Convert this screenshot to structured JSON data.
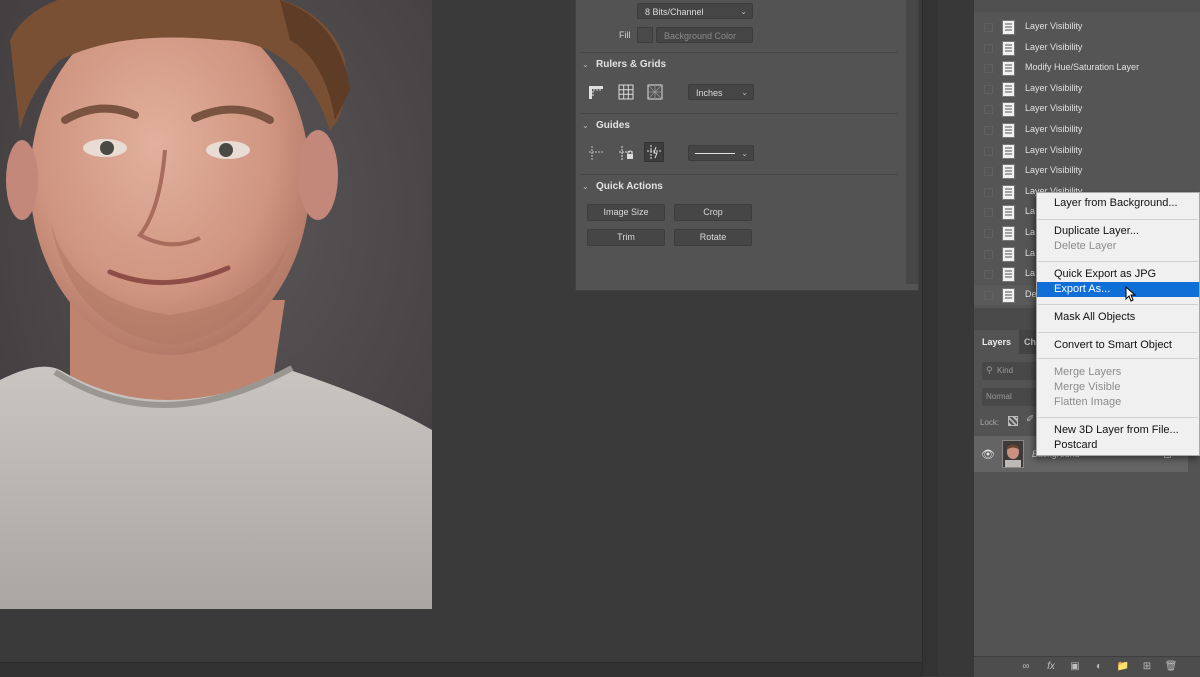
{
  "properties": {
    "bit_depth": "8 Bits/Channel",
    "fill_label": "Fill",
    "fill_value": "Background Color",
    "rulers_section": "Rulers & Grids",
    "units": "Inches",
    "guides_section": "Guides",
    "quick_actions_section": "Quick Actions",
    "buttons": {
      "image_size": "Image Size",
      "crop": "Crop",
      "trim": "Trim",
      "rotate": "Rotate"
    }
  },
  "history": {
    "items": [
      "Layer Visibility",
      "Layer Visibility",
      "Modify Hue/Saturation Layer",
      "Layer Visibility",
      "Layer Visibility",
      "Layer Visibility",
      "Layer Visibility",
      "Layer Visibility",
      "Layer Visibility",
      "La",
      "La",
      "La",
      "La",
      "De"
    ]
  },
  "layers_panel": {
    "tabs": [
      "Layers",
      "Ch"
    ],
    "search_placeholder": "Kind",
    "blend_mode": "Normal",
    "lock_label": "Lock:",
    "layer_name": "Background"
  },
  "context_menu": {
    "items": [
      {
        "label": "Layer from Background...",
        "disabled": false
      },
      {
        "label": "Duplicate Layer...",
        "disabled": false
      },
      {
        "label": "Delete Layer",
        "disabled": true
      },
      {
        "label": "Quick Export as JPG",
        "disabled": false
      },
      {
        "label": "Export As...",
        "disabled": false,
        "highlighted": true
      },
      {
        "label": "Mask All Objects",
        "disabled": false
      },
      {
        "label": "Convert to Smart Object",
        "disabled": false
      },
      {
        "label": "Merge Layers",
        "disabled": true
      },
      {
        "label": "Merge Visible",
        "disabled": true
      },
      {
        "label": "Flatten Image",
        "disabled": true
      },
      {
        "label": "New 3D Layer from File...",
        "disabled": false
      },
      {
        "label": "Postcard",
        "disabled": false
      }
    ]
  },
  "colors": {
    "menu_highlight": "#0f6fd6",
    "panel_bg": "#535353",
    "canvas_bg": "#3a3a3a"
  }
}
